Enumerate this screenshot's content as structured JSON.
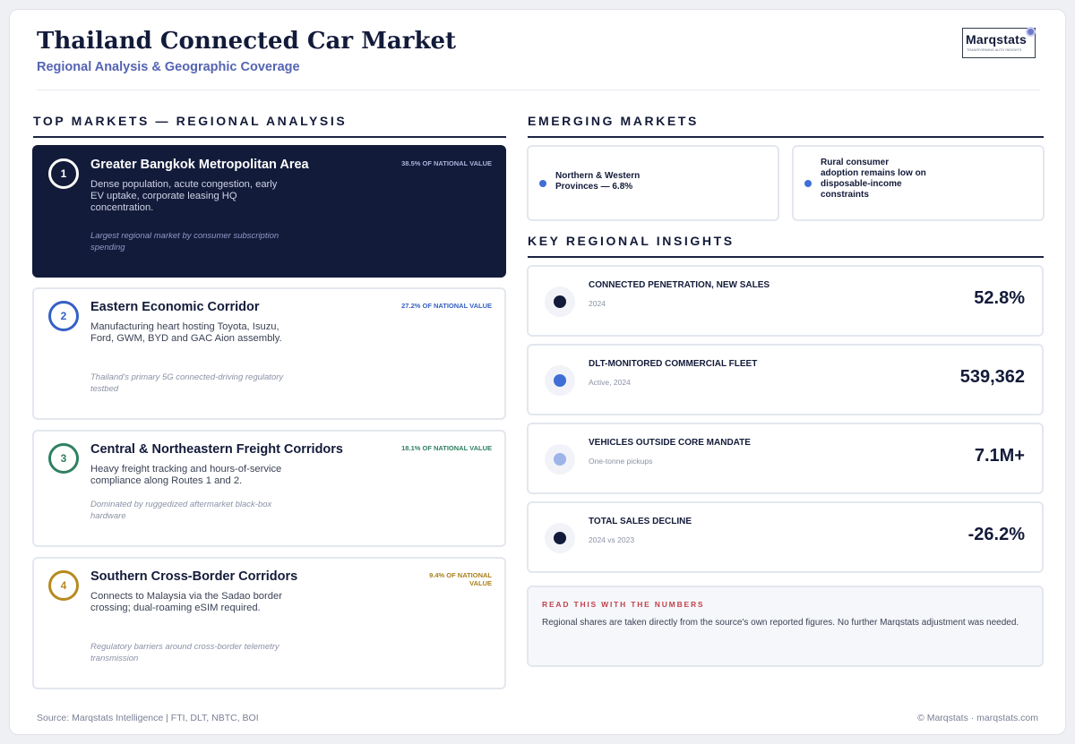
{
  "header": {
    "title": "Thailand Connected Car Market",
    "subtitle": "Regional Analysis & Geographic Coverage",
    "logo_word": "Marqstats",
    "logo_tagline": "Transforming auto insights"
  },
  "top_markets": {
    "heading": "TOP MARKETS — REGIONAL ANALYSIS",
    "items": [
      {
        "rank": "1",
        "name": "Greater Bangkok Metropolitan Area",
        "share": "38.5% OF NATIONAL VALUE",
        "description": "Dense population, acute congestion, early EV uptake, corporate leasing HQ concentration.",
        "note": "Largest regional market by consumer subscription spending",
        "accent": "#ffffff"
      },
      {
        "rank": "2",
        "name": "Eastern Economic Corridor",
        "share": "27.2% OF NATIONAL VALUE",
        "description": "Manufacturing heart hosting Toyota, Isuzu, Ford, GWM, BYD and GAC Aion assembly.",
        "note": "Thailand's primary 5G connected-driving regulatory testbed",
        "accent": "#3560c4"
      },
      {
        "rank": "3",
        "name": "Central & Northeastern Freight Corridors",
        "share": "18.1% OF NATIONAL VALUE",
        "description": "Heavy freight tracking and hours-of-service compliance along Routes 1 and 2.",
        "note": "Dominated by ruggedized aftermarket black-box hardware",
        "accent": "#2f8060"
      },
      {
        "rank": "4",
        "name": "Southern Cross-Border Corridors",
        "share": "9.4% OF NATIONAL VALUE",
        "description": "Connects to Malaysia via the Sadao border crossing; dual-roaming eSIM required.",
        "note": "Regulatory barriers around cross-border telemetry transmission",
        "accent": "#b78a1f"
      }
    ]
  },
  "emerging": {
    "heading": "EMERGING MARKETS",
    "items": [
      {
        "text": "Northern & Western Provinces — 6.8%"
      },
      {
        "text": "Rural consumer adoption remains low on disposable-income constraints"
      }
    ]
  },
  "insights": {
    "heading": "KEY REGIONAL INSIGHTS",
    "items": [
      {
        "label": "CONNECTED PENETRATION, NEW SALES",
        "sub": "2024",
        "value": "52.8%",
        "dot_color": "#131b3a"
      },
      {
        "label": "DLT-MONITORED COMMERCIAL FLEET",
        "sub": "Active, 2024",
        "value": "539,362",
        "dot_color": "#3f6fd6"
      },
      {
        "label": "VEHICLES OUTSIDE CORE MANDATE",
        "sub": "One-tonne pickups",
        "value": "7.1M+",
        "dot_color": "#9db3ea"
      },
      {
        "label": "TOTAL SALES DECLINE",
        "sub": "2024 vs 2023",
        "value": "-26.2%",
        "dot_color": "#131b3a"
      }
    ]
  },
  "read_note": {
    "heading": "READ THIS WITH THE NUMBERS",
    "body": "Regional shares are taken directly from the source's own reported figures. No further Marqstats adjustment was needed."
  },
  "footer": {
    "source": "Source: Marqstats Intelligence | FTI, DLT, NBTC, BOI",
    "copyright": "© Marqstats · marqstats.com"
  }
}
